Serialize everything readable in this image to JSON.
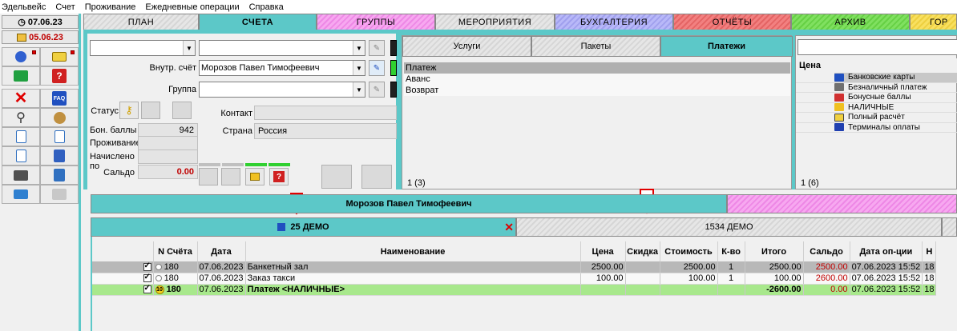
{
  "menu": [
    "Эдельвейс",
    "Счет",
    "Проживание",
    "Ежедневные операции",
    "Справка"
  ],
  "dates": {
    "date1": "07.06.23",
    "date2": "05.06.23"
  },
  "top_tabs": [
    "ПЛАН",
    "СЧЕТА",
    "ГРУППЫ",
    "МЕРОПРИЯТИЯ",
    "БУХГАЛТЕРИЯ",
    "ОТЧЁТЫ",
    "АРХИВ",
    "ГОР"
  ],
  "form": {
    "inner_account_label": "Внутр. счёт",
    "inner_account_value": "Морозов Павел Тимофеевич",
    "group_label": "Группа",
    "status_label": "Статус",
    "bonus_label": "Бон. баллы",
    "bonus_value": "942",
    "living_label": "Проживание",
    "accrued_label": "Начислено по",
    "saldo_label": "Сальдо",
    "saldo_value": "0.00",
    "contact_label": "Контакт",
    "country_label": "Страна",
    "country_value": "Россия"
  },
  "sub_tabs": [
    "Услуги",
    "Пакеты",
    "Платежи"
  ],
  "payment_types": [
    "Платеж",
    "Аванс",
    "Возврат"
  ],
  "payment_count": "1 (3)",
  "right_panel": {
    "header": "Цена",
    "items": [
      "Банковские карты",
      "Безналичный платеж",
      "Бонусные баллы",
      "НАЛИЧНЫЕ",
      "Полный расчёт",
      "Терминалы оплаты"
    ],
    "count": "1 (6)"
  },
  "person_bar": "Морозов Павел Тимофеевич",
  "account_tabs": {
    "tab1": "25 ДЕМО",
    "tab2": "1534 ДЕМО"
  },
  "table": {
    "headers": [
      "N Счёта",
      "Дата",
      "Наименование",
      "Цена",
      "Скидка",
      "Стоимость",
      "К-во",
      "Итого",
      "Сальдо",
      "Дата оп-ции",
      "Н"
    ],
    "rows": [
      {
        "acc": "180",
        "date": "07.06.2023",
        "name": "Банкетный зал",
        "price": "2500.00",
        "discount": "",
        "cost": "2500.00",
        "qty": "1",
        "total": "2500.00",
        "saldo": "2500.00",
        "opdate": "07.06.2023 15:52",
        "n": "18"
      },
      {
        "acc": "180",
        "date": "07.06.2023",
        "name": "Заказ такси",
        "price": "100.00",
        "discount": "",
        "cost": "100.00",
        "qty": "1",
        "total": "100.00",
        "saldo": "2600.00",
        "opdate": "07.06.2023 15:52",
        "n": "18"
      },
      {
        "acc": "180",
        "date": "07.06.2023",
        "name": "Платеж <НАЛИЧНЫЕ>",
        "price": "",
        "discount": "",
        "cost": "",
        "qty": "",
        "total": "-2600.00",
        "saldo": "0.00",
        "opdate": "07.06.2023 15:52",
        "n": "18"
      }
    ]
  },
  "colors": {
    "teal": "#5cc8c8",
    "payment_row": "#a8e88c",
    "saldo_red": "#c00000"
  }
}
